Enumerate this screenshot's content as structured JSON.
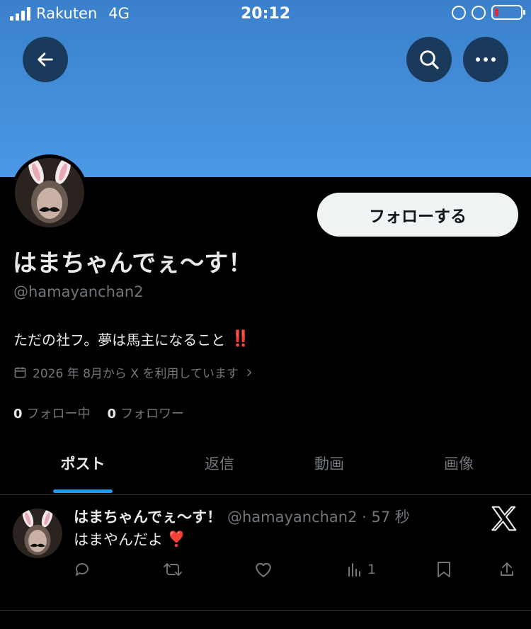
{
  "status_bar": {
    "carrier": "Rakuten",
    "network": "4G",
    "time": "20:12"
  },
  "header": {
    "back_icon": "arrow-left-icon",
    "search_icon": "search-icon",
    "more_icon": "more-horizontal-icon",
    "banner_color": "#4593de"
  },
  "profile": {
    "follow_label": "フォローする",
    "display_name": "はまちゃんでぇ〜す！",
    "handle": "@hamayanchan2",
    "bio": "ただの社フ。夢は馬主になること",
    "bio_emoji": "‼️",
    "joined": "2026 年 8月から X を利用しています",
    "following_count": "0",
    "following_label": "フォロー中",
    "followers_count": "0",
    "followers_label": "フォロワー"
  },
  "tabs": [
    {
      "label": "ポスト",
      "active": true
    },
    {
      "label": "返信",
      "active": false
    },
    {
      "label": "動画",
      "active": false
    },
    {
      "label": "画像",
      "active": false
    }
  ],
  "post": {
    "name": "はまちゃんでぇ〜す！",
    "meta": "@hamayanchan2 · 57 秒",
    "text": "はまやんだよ",
    "emoji": "❣️",
    "views": "1"
  },
  "colors": {
    "accent": "#1d9bf0",
    "muted": "#71767b",
    "text": "#e7e9ea",
    "bg": "#000000"
  }
}
